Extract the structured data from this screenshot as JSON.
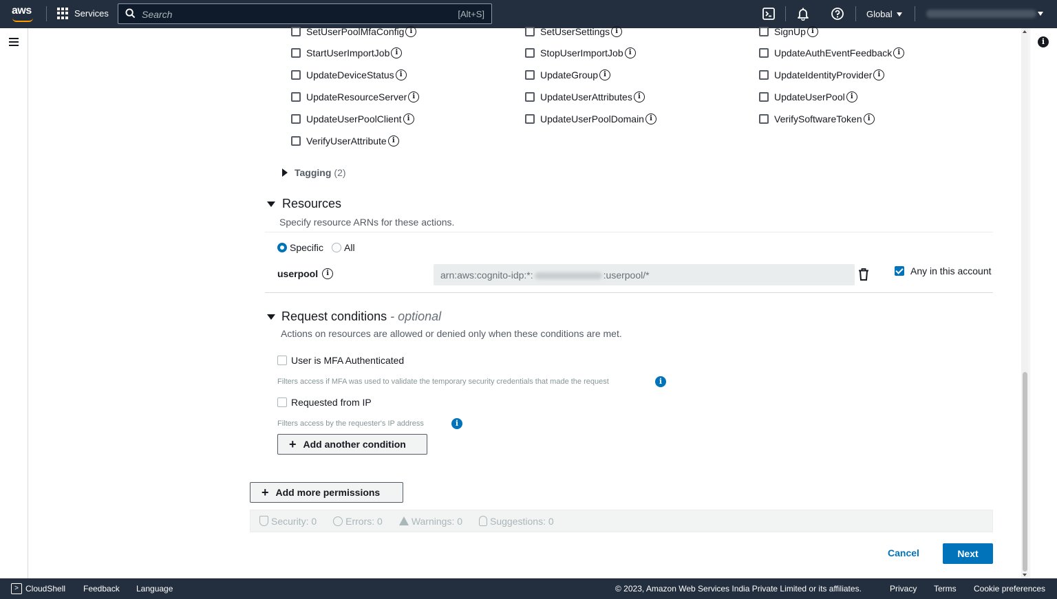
{
  "topnav": {
    "logo_text": "aws",
    "services_label": "Services",
    "search_placeholder": "Search",
    "search_shortcut": "[Alt+S]",
    "region_label": "Global"
  },
  "actions": {
    "col1": [
      "SetUserPoolMfaConfig",
      "StartUserImportJob",
      "UpdateDeviceStatus",
      "UpdateResourceServer",
      "UpdateUserPoolClient",
      "VerifyUserAttribute"
    ],
    "col2": [
      "SetUserSettings",
      "StopUserImportJob",
      "UpdateGroup",
      "UpdateUserAttributes",
      "UpdateUserPoolDomain"
    ],
    "col3": [
      "SignUp",
      "UpdateAuthEventFeedback",
      "UpdateIdentityProvider",
      "UpdateUserPool",
      "VerifySoftwareToken"
    ]
  },
  "tagging": {
    "label": "Tagging",
    "count": "(2)"
  },
  "resources": {
    "title": "Resources",
    "description": "Specify resource ARNs for these actions.",
    "radio_specific": "Specific",
    "radio_all": "All",
    "selected": "Specific",
    "userpool_label": "userpool",
    "arn_prefix": "arn:aws:cognito-idp:*:",
    "arn_suffix": ":userpool/*",
    "any_account_label": "Any in this account",
    "any_account_checked": true
  },
  "conditions": {
    "title": "Request conditions",
    "optional": "- optional",
    "description": "Actions on resources are allowed or denied only when these conditions are met.",
    "mfa_label": "User is MFA Authenticated",
    "mfa_hint": "Filters access if MFA was used to validate the temporary security credentials that made the request",
    "ip_label": "Requested from IP",
    "ip_hint": "Filters access by the requester's IP address",
    "add_condition": "Add another condition"
  },
  "add_more_permissions": "Add more permissions",
  "status": {
    "security": "Security: 0",
    "errors": "Errors: 0",
    "warnings": "Warnings: 0",
    "suggestions": "Suggestions: 0"
  },
  "buttons": {
    "cancel": "Cancel",
    "next": "Next"
  },
  "footer": {
    "cloudshell": "CloudShell",
    "feedback": "Feedback",
    "language": "Language",
    "copyright": "© 2023, Amazon Web Services India Private Limited or its affiliates.",
    "privacy": "Privacy",
    "terms": "Terms",
    "cookie": "Cookie preferences"
  },
  "colors": {
    "nav_bg": "#232f3e",
    "primary": "#0073bb",
    "accent": "#ff9900"
  }
}
